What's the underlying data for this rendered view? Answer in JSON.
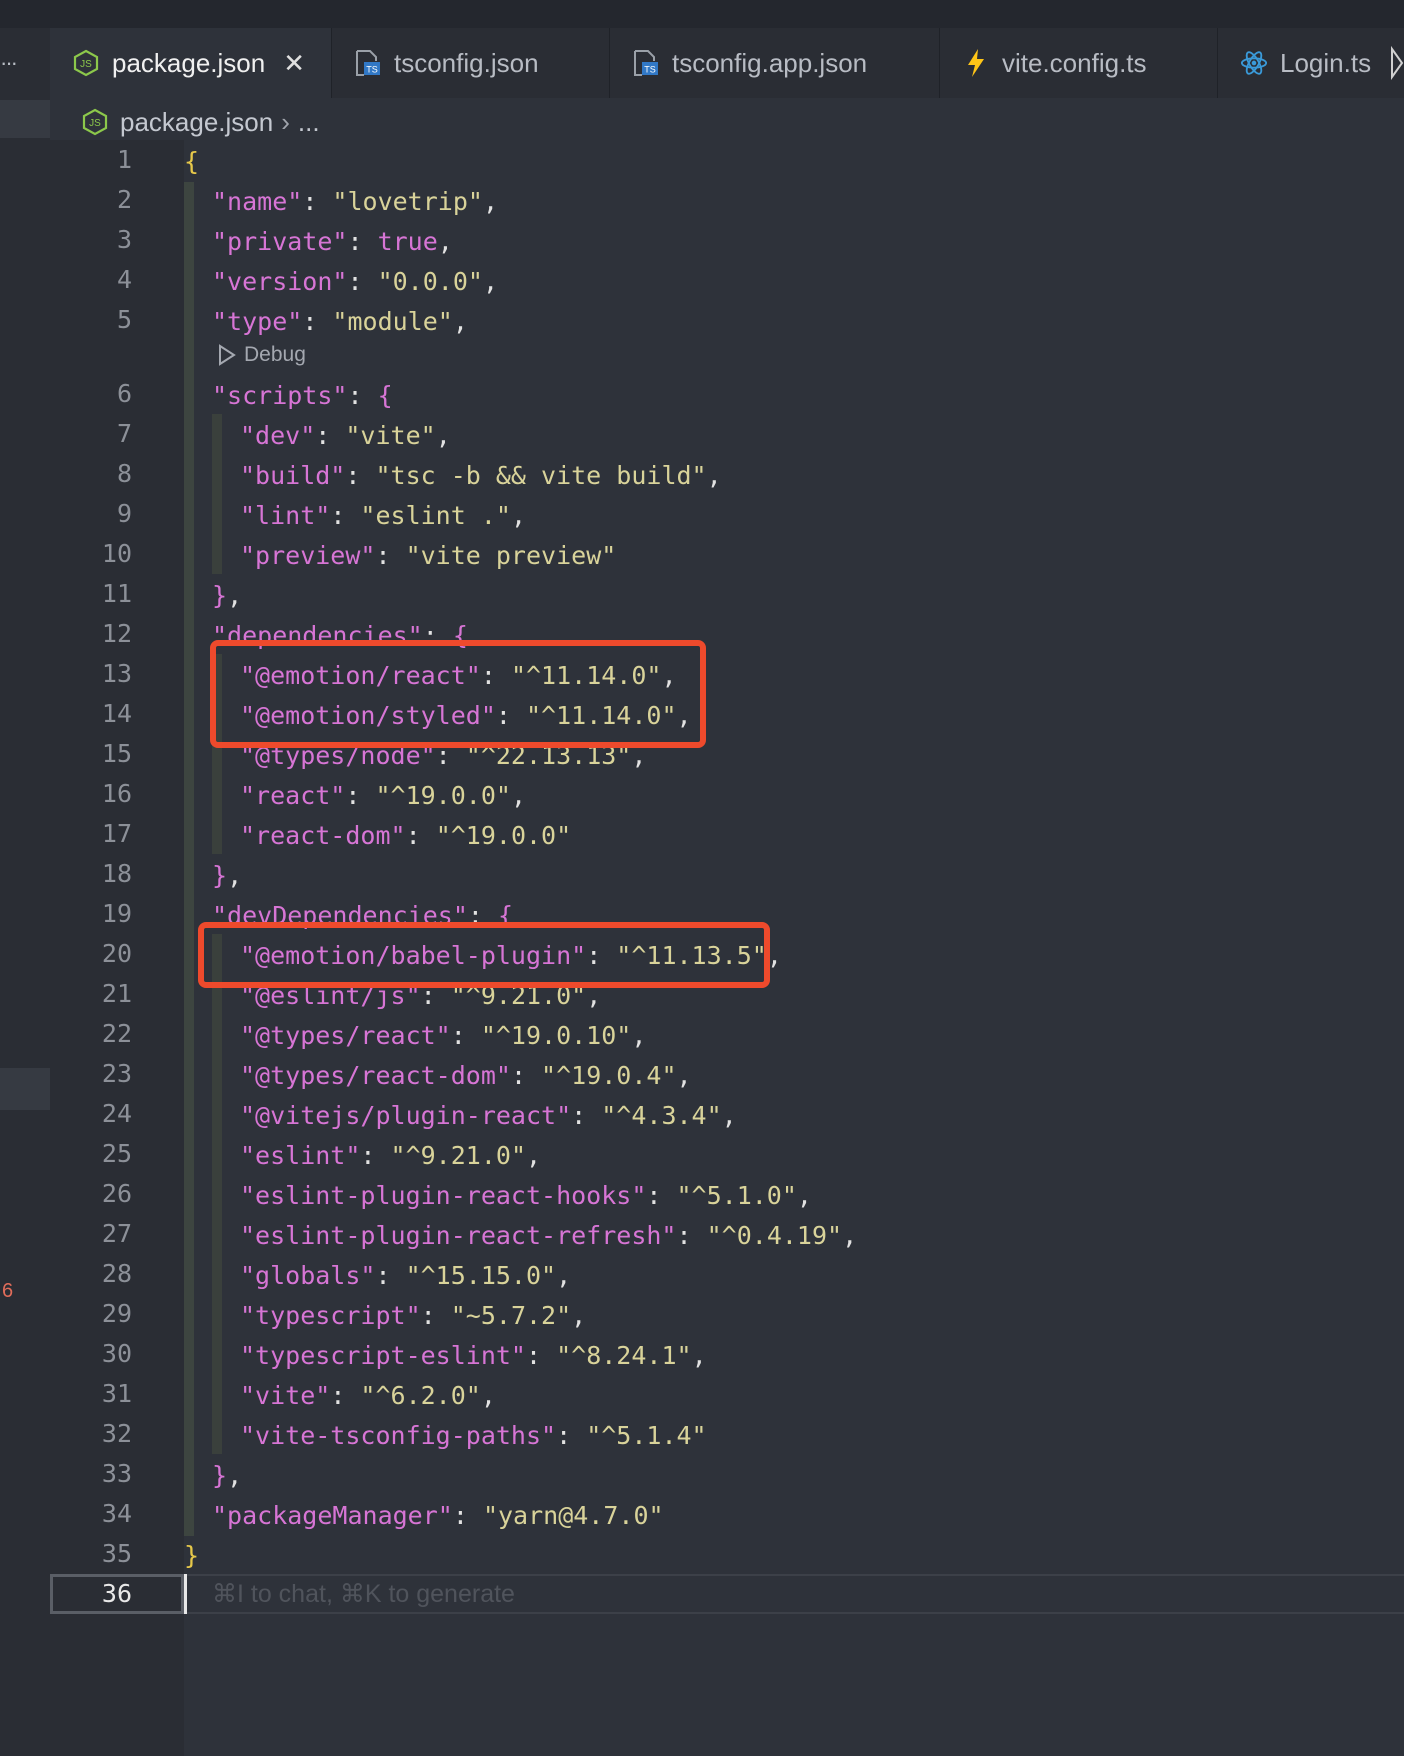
{
  "tabs": [
    {
      "label": "package.json",
      "icon": "nodejs-icon",
      "active": true
    },
    {
      "label": "tsconfig.json",
      "icon": "typescript-config-icon"
    },
    {
      "label": "tsconfig.app.json",
      "icon": "typescript-config-icon"
    },
    {
      "label": "vite.config.ts",
      "icon": "vite-bolt-icon"
    },
    {
      "label": "Login.ts",
      "icon": "react-icon"
    }
  ],
  "left_strip": {
    "more": "···",
    "error_count": "6"
  },
  "breadcrumb": {
    "file": "package.json",
    "rest": "..."
  },
  "codelens": {
    "label": "Debug"
  },
  "hint": "⌘I to chat, ⌘K to generate",
  "current_line": 36,
  "line_numbers": [
    "1",
    "2",
    "3",
    "4",
    "5",
    "6",
    "7",
    "8",
    "9",
    "10",
    "11",
    "12",
    "13",
    "14",
    "15",
    "16",
    "17",
    "18",
    "19",
    "20",
    "21",
    "22",
    "23",
    "24",
    "25",
    "26",
    "27",
    "28",
    "29",
    "30",
    "31",
    "32",
    "33",
    "34",
    "35",
    "36"
  ],
  "code": {
    "l1": "{",
    "l2_k": "\"name\"",
    "l2_v": "\"lovetrip\"",
    "l3_k": "\"private\"",
    "l3_v": "true",
    "l4_k": "\"version\"",
    "l4_v": "\"0.0.0\"",
    "l5_k": "\"type\"",
    "l5_v": "\"module\"",
    "l6_k": "\"scripts\"",
    "l7_k": "\"dev\"",
    "l7_v": "\"vite\"",
    "l8_k": "\"build\"",
    "l8_v": "\"tsc -b && vite build\"",
    "l9_k": "\"lint\"",
    "l9_v": "\"eslint .\"",
    "l10_k": "\"preview\"",
    "l10_v": "\"vite preview\"",
    "l12_k": "\"dependencies\"",
    "l13_k": "\"@emotion/react\"",
    "l13_v": "\"^11.14.0\"",
    "l14_k": "\"@emotion/styled\"",
    "l14_v": "\"^11.14.0\"",
    "l15_k": "\"@types/node\"",
    "l15_v": "\"^22.13.13\"",
    "l16_k": "\"react\"",
    "l16_v": "\"^19.0.0\"",
    "l17_k": "\"react-dom\"",
    "l17_v": "\"^19.0.0\"",
    "l19_k": "\"devDependencies\"",
    "l20_k": "\"@emotion/babel-plugin\"",
    "l20_v": "\"^11.13.5\"",
    "l21_k": "\"@eslint/js\"",
    "l21_v": "\"^9.21.0\"",
    "l22_k": "\"@types/react\"",
    "l22_v": "\"^19.0.10\"",
    "l23_k": "\"@types/react-dom\"",
    "l23_v": "\"^19.0.4\"",
    "l24_k": "\"@vitejs/plugin-react\"",
    "l24_v": "\"^4.3.4\"",
    "l25_k": "\"eslint\"",
    "l25_v": "\"^9.21.0\"",
    "l26_k": "\"eslint-plugin-react-hooks\"",
    "l26_v": "\"^5.1.0\"",
    "l27_k": "\"eslint-plugin-react-refresh\"",
    "l27_v": "\"^0.4.19\"",
    "l28_k": "\"globals\"",
    "l28_v": "\"^15.15.0\"",
    "l29_k": "\"typescript\"",
    "l29_v": "\"~5.7.2\"",
    "l30_k": "\"typescript-eslint\"",
    "l30_v": "\"^8.24.1\"",
    "l31_k": "\"vite\"",
    "l31_v": "\"^6.2.0\"",
    "l32_k": "\"vite-tsconfig-paths\"",
    "l32_v": "\"^5.1.4\"",
    "l34_k": "\"packageManager\"",
    "l34_v": "\"yarn@4.7.0\"",
    "l35": "}"
  },
  "colors": {
    "highlight_box": "#ee4a2c",
    "json_key": "#d775d5",
    "json_string": "#d9d39a",
    "brace": "#e6c84a"
  }
}
